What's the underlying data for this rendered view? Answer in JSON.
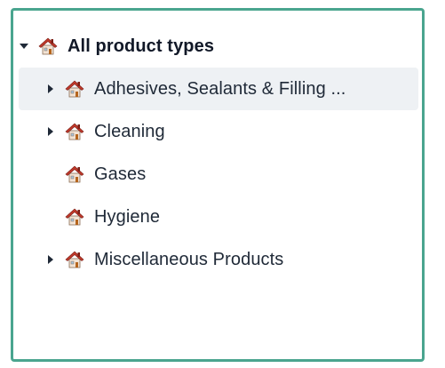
{
  "tree": {
    "root": {
      "label": "All product types",
      "expanded": true,
      "icon": "house-icon"
    },
    "children": [
      {
        "label": "Adhesives, Sealants & Filling ...",
        "has_children": true,
        "expanded": false,
        "icon": "house-icon",
        "highlighted": true
      },
      {
        "label": "Cleaning",
        "has_children": true,
        "expanded": false,
        "icon": "house-icon",
        "highlighted": false
      },
      {
        "label": "Gases",
        "has_children": false,
        "expanded": false,
        "icon": "house-icon",
        "highlighted": false
      },
      {
        "label": "Hygiene",
        "has_children": false,
        "expanded": false,
        "icon": "house-icon",
        "highlighted": false
      },
      {
        "label": "Miscellaneous Products",
        "has_children": true,
        "expanded": false,
        "icon": "house-icon",
        "highlighted": false
      }
    ]
  },
  "colors": {
    "border": "#4aa58f",
    "highlight_bg": "#eef1f4",
    "text": "#1f2937",
    "roof": "#c0392b",
    "wall": "#f2e3d5"
  }
}
